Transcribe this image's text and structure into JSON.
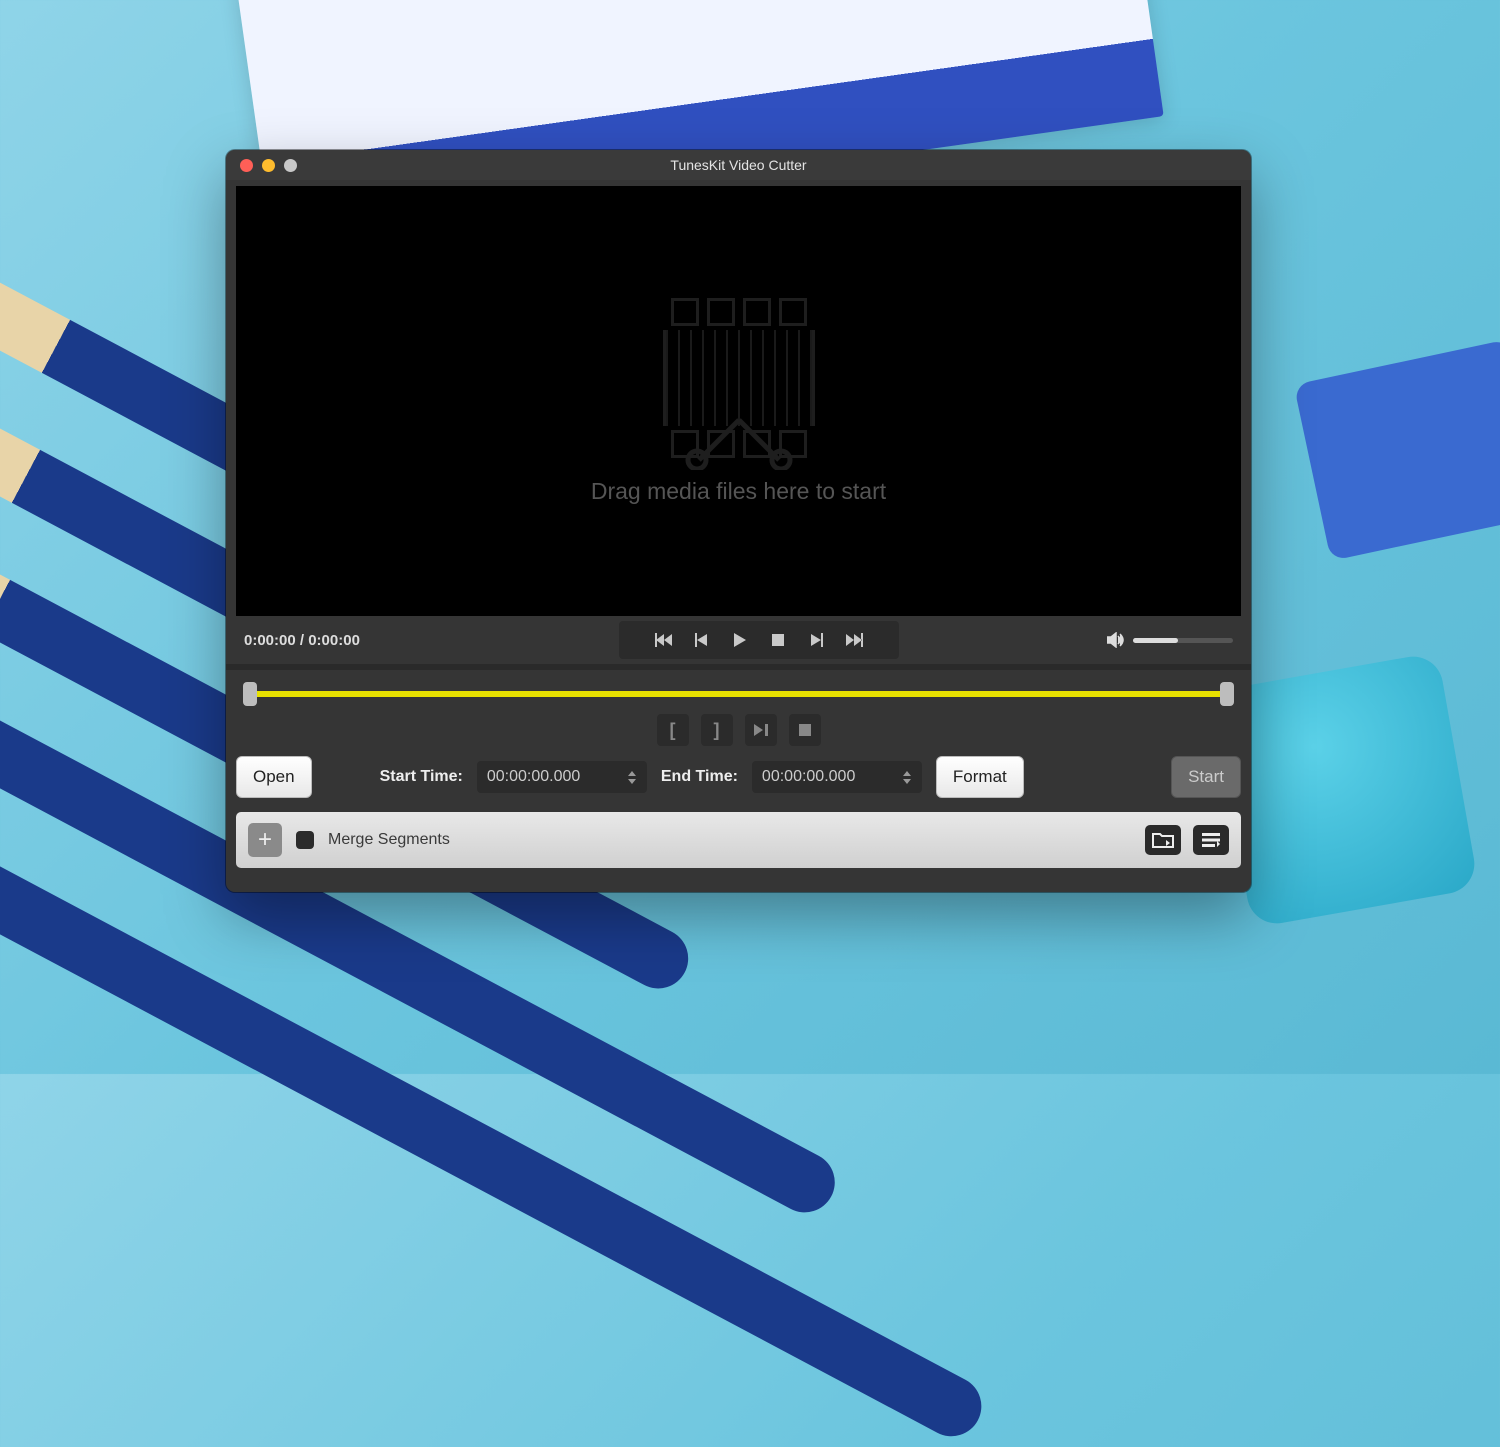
{
  "window": {
    "title": "TunesKit Video Cutter"
  },
  "preview": {
    "dropzone_text": "Drag media files here to start"
  },
  "playbar": {
    "current_time": "0:00:00",
    "total_time": "0:00:00",
    "volume_percent": 45
  },
  "edit": {
    "open_label": "Open",
    "start_label": "Start Time:",
    "start_value": "00:00:00.000",
    "end_label": "End Time:",
    "end_value": "00:00:00.000",
    "format_label": "Format",
    "start_button_label": "Start",
    "range_start_percent": 0,
    "range_end_percent": 100
  },
  "bottom": {
    "merge_label": "Merge Segments",
    "merge_checked": false
  },
  "icons": {
    "prev_end": "prev-end",
    "step_back": "step-back",
    "play": "play",
    "stop": "stop",
    "step_fwd": "step-fwd",
    "next_end": "next-end",
    "volume": "volume",
    "bracket_in": "[",
    "bracket_out": "]",
    "play_cut": "play-cut",
    "stop_cut": "stop-cut",
    "folder": "folder",
    "list": "list",
    "add": "+"
  }
}
